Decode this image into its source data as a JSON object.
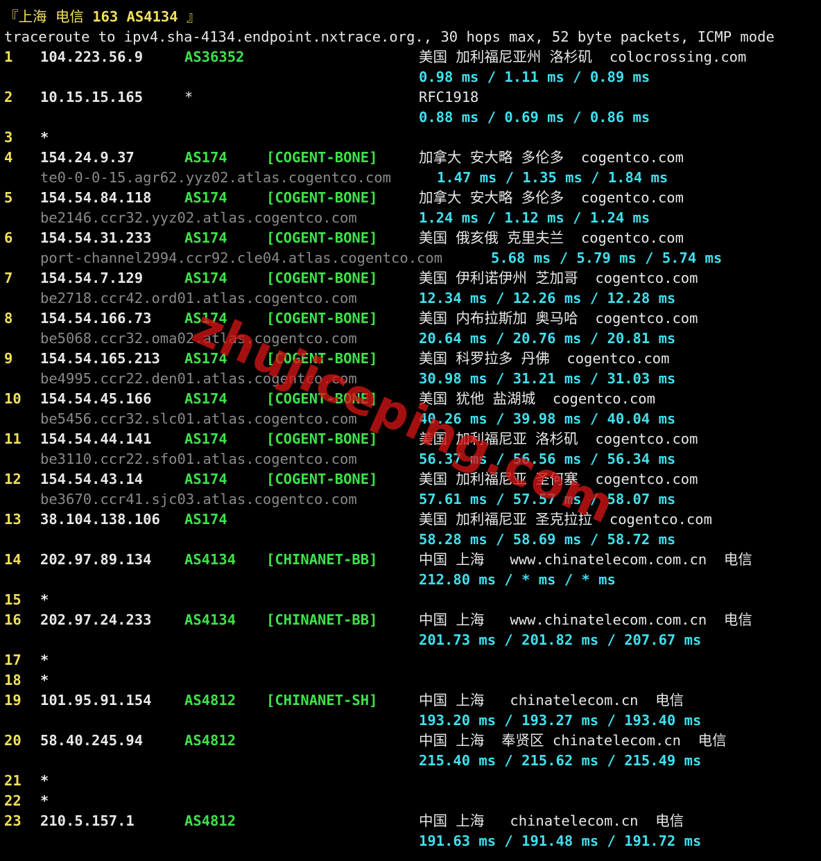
{
  "header": {
    "title_prefix": "『上海 电信 ",
    "title_bold": "163 AS4134",
    "title_suffix": " 』",
    "command": "traceroute to ipv4.sha-4134.endpoint.nxtrace.org., 30 hops max, 52 byte packets, ICMP mode"
  },
  "watermark": "zhujiceping.com",
  "colors": {
    "hop": "#f2e15b",
    "asn": "#3ee24a",
    "rtt": "#40e0ee",
    "hostname": "#8a8a8a",
    "text": "#e8e8e8",
    "background": "#000000"
  },
  "hops": [
    {
      "n": "1",
      "ip": "104.223.56.9",
      "asn": "AS36352",
      "tag": "",
      "geo": "美国 加利福尼亚州 洛杉矶  colocrossing.com",
      "rtt": "0.98 ms / 1.11 ms / 0.89 ms"
    },
    {
      "n": "2",
      "ip": "10.15.15.165",
      "asn": "*",
      "tag": "",
      "geo": "RFC1918",
      "rtt": "0.88 ms / 0.69 ms / 0.86 ms"
    },
    {
      "n": "3",
      "ip": "*"
    },
    {
      "n": "4",
      "ip": "154.24.9.37",
      "asn": "AS174",
      "tag": "[COGENT-BONE]",
      "geo": "加拿大 安大略 多伦多  cogentco.com",
      "host": "te0-0-0-15.agr62.yyz02.atlas.cogentco.com",
      "rtt": "1.47 ms / 1.35 ms / 1.84 ms"
    },
    {
      "n": "5",
      "ip": "154.54.84.118",
      "asn": "AS174",
      "tag": "[COGENT-BONE]",
      "geo": "加拿大 安大略 多伦多  cogentco.com",
      "host": "be2146.ccr32.yyz02.atlas.cogentco.com",
      "rtt": "1.24 ms / 1.12 ms / 1.24 ms"
    },
    {
      "n": "6",
      "ip": "154.54.31.233",
      "asn": "AS174",
      "tag": "[COGENT-BONE]",
      "geo": "美国 俄亥俄 克里夫兰  cogentco.com",
      "host": "port-channel2994.ccr92.cle04.atlas.cogentco.com",
      "rtt": "5.68 ms / 5.79 ms / 5.74 ms"
    },
    {
      "n": "7",
      "ip": "154.54.7.129",
      "asn": "AS174",
      "tag": "[COGENT-BONE]",
      "geo": "美国 伊利诺伊州 芝加哥  cogentco.com",
      "host": "be2718.ccr42.ord01.atlas.cogentco.com",
      "rtt": "12.34 ms / 12.26 ms / 12.28 ms"
    },
    {
      "n": "8",
      "ip": "154.54.166.73",
      "asn": "AS174",
      "tag": "[COGENT-BONE]",
      "geo": "美国 内布拉斯加 奥马哈  cogentco.com",
      "host": "be5068.ccr32.oma02.atlas.cogentco.com",
      "rtt": "20.64 ms / 20.76 ms / 20.81 ms"
    },
    {
      "n": "9",
      "ip": "154.54.165.213",
      "asn": "AS174",
      "tag": "[COGENT-BONE]",
      "geo": "美国 科罗拉多 丹佛  cogentco.com",
      "host": "be4995.ccr22.den01.atlas.cogentco.com",
      "rtt": "30.98 ms / 31.21 ms / 31.03 ms"
    },
    {
      "n": "10",
      "ip": "154.54.45.166",
      "asn": "AS174",
      "tag": "[COGENT-BONE]",
      "geo": "美国 犹他 盐湖城  cogentco.com",
      "host": "be5456.ccr32.slc01.atlas.cogentco.com",
      "rtt": "40.26 ms / 39.98 ms / 40.04 ms"
    },
    {
      "n": "11",
      "ip": "154.54.44.141",
      "asn": "AS174",
      "tag": "[COGENT-BONE]",
      "geo": "美国 加利福尼亚 洛杉矶  cogentco.com",
      "host": "be3110.ccr22.sfo01.atlas.cogentco.com",
      "rtt": "56.37 ms / 56.56 ms / 56.34 ms"
    },
    {
      "n": "12",
      "ip": "154.54.43.14",
      "asn": "AS174",
      "tag": "[COGENT-BONE]",
      "geo": "美国 加利福尼亚 圣何塞  cogentco.com",
      "host": "be3670.ccr41.sjc03.atlas.cogentco.com",
      "rtt": "57.61 ms / 57.57 ms / 58.07 ms"
    },
    {
      "n": "13",
      "ip": "38.104.138.106",
      "asn": "AS174",
      "tag": "",
      "geo": "美国 加利福尼亚 圣克拉拉  cogentco.com",
      "rtt": "58.28 ms / 58.69 ms / 58.72 ms"
    },
    {
      "n": "14",
      "ip": "202.97.89.134",
      "asn": "AS4134",
      "tag": "[CHINANET-BB]",
      "geo": "中国 上海   www.chinatelecom.com.cn  电信",
      "rtt": "212.80 ms / * ms / * ms"
    },
    {
      "n": "15",
      "ip": "*"
    },
    {
      "n": "16",
      "ip": "202.97.24.233",
      "asn": "AS4134",
      "tag": "[CHINANET-BB]",
      "geo": "中国 上海   www.chinatelecom.com.cn  电信",
      "rtt": "201.73 ms / 201.82 ms / 207.67 ms"
    },
    {
      "n": "17",
      "ip": "*"
    },
    {
      "n": "18",
      "ip": "*"
    },
    {
      "n": "19",
      "ip": "101.95.91.154",
      "asn": "AS4812",
      "tag": "[CHINANET-SH]",
      "geo": "中国 上海   chinatelecom.cn  电信",
      "rtt": "193.20 ms / 193.27 ms / 193.40 ms"
    },
    {
      "n": "20",
      "ip": "58.40.245.94",
      "asn": "AS4812",
      "tag": "",
      "geo": "中国 上海  奉贤区 chinatelecom.cn  电信",
      "rtt": "215.40 ms / 215.62 ms / 215.49 ms"
    },
    {
      "n": "21",
      "ip": "*"
    },
    {
      "n": "22",
      "ip": "*"
    },
    {
      "n": "23",
      "ip": "210.5.157.1",
      "asn": "AS4812",
      "tag": "",
      "geo": "中国 上海   chinatelecom.cn  电信",
      "rtt": "191.63 ms / 191.48 ms / 191.72 ms"
    }
  ]
}
